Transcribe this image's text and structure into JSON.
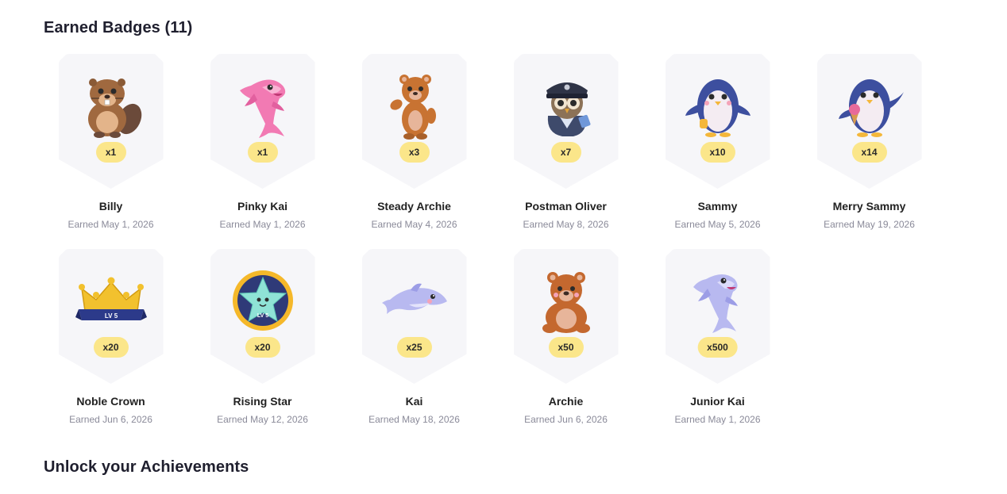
{
  "earned_title": "Earned Badges (11)",
  "unlock_title": "Unlock your Achievements",
  "badges": [
    {
      "name": "Billy",
      "count": "x1",
      "date": "Earned May 1, 2026",
      "icon": "beaver-icon"
    },
    {
      "name": "Pinky Kai",
      "count": "x1",
      "date": "Earned May 1, 2026",
      "icon": "pink-dolphin-icon"
    },
    {
      "name": "Steady Archie",
      "count": "x3",
      "date": "Earned May 4, 2026",
      "icon": "waving-bear-icon"
    },
    {
      "name": "Postman Oliver",
      "count": "x7",
      "date": "Earned May 8, 2026",
      "icon": "postman-owl-icon"
    },
    {
      "name": "Sammy",
      "count": "x10",
      "date": "Earned May 5, 2026",
      "icon": "penguin-icon"
    },
    {
      "name": "Merry Sammy",
      "count": "x14",
      "date": "Earned May 19, 2026",
      "icon": "ice-cream-penguin-icon"
    },
    {
      "name": "Noble Crown",
      "count": "x20",
      "date": "Earned Jun 6, 2026",
      "icon": "crown-icon",
      "art_label": "LV 5"
    },
    {
      "name": "Rising Star",
      "count": "x20",
      "date": "Earned May 12, 2026",
      "icon": "star-medal-icon",
      "art_label": "LV 5"
    },
    {
      "name": "Kai",
      "count": "x25",
      "date": "Earned May 18, 2026",
      "icon": "dolphin-icon"
    },
    {
      "name": "Archie",
      "count": "x50",
      "date": "Earned Jun 6, 2026",
      "icon": "bear-icon"
    },
    {
      "name": "Junior Kai",
      "count": "x500",
      "date": "Earned May 1, 2026",
      "icon": "jumping-dolphin-icon"
    }
  ],
  "colors": {
    "pill": "#fbe68a",
    "card": "#f6f6f9",
    "date_text": "#8a8a99"
  }
}
